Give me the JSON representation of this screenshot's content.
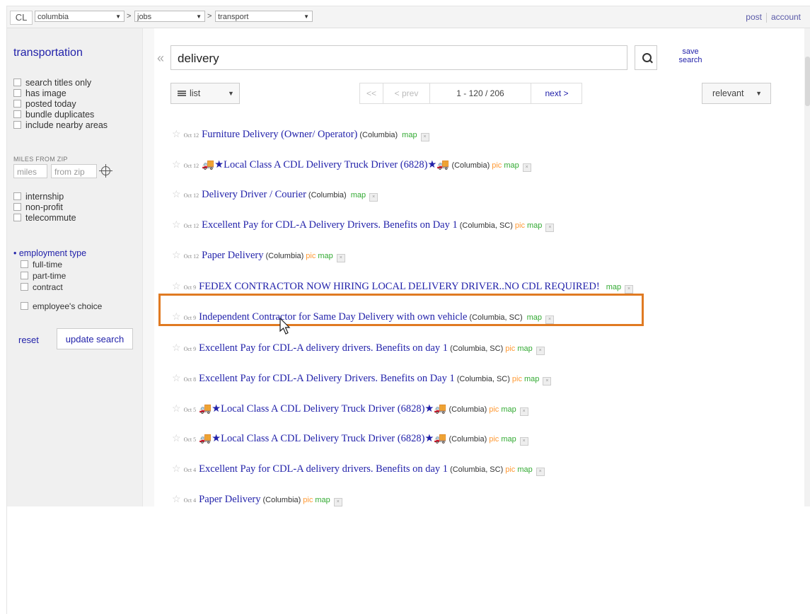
{
  "topbar": {
    "logo": "CL",
    "area": "columbia",
    "section": "jobs",
    "category": "transport",
    "sep": ">",
    "post": "post",
    "account": "account"
  },
  "sidebar": {
    "title": "transportation",
    "filters": [
      "search titles only",
      "has image",
      "posted today",
      "bundle duplicates",
      "include nearby areas"
    ],
    "miles_label": "MILES FROM ZIP",
    "miles_placeholder": "miles",
    "zip_placeholder": "from zip",
    "extras": [
      "internship",
      "non-profit",
      "telecommute"
    ],
    "employment_title": "employment type",
    "employment": [
      "full-time",
      "part-time",
      "contract",
      "employee's choice"
    ],
    "reset": "reset",
    "update": "update search"
  },
  "search": {
    "collapse": "«",
    "query": "delivery",
    "save": "save search"
  },
  "toolbar": {
    "view": "list",
    "first": "<<",
    "prev": "< prev",
    "range": "1 - 120 / 206",
    "next": "next >",
    "sort": "relevant"
  },
  "results": [
    {
      "date": "Oct 12",
      "title": "Furniture Delivery (Owner/ Operator)",
      "hood": "(Columbia)",
      "pic": "",
      "map": "map"
    },
    {
      "date": "Oct 12",
      "title": "🚚★Local Class A CDL Delivery Truck Driver (6828)★🚚",
      "hood": "(Columbia)",
      "pic": "pic",
      "map": "map"
    },
    {
      "date": "Oct 12",
      "title": "Delivery Driver / Courier",
      "hood": "(Columbia)",
      "pic": "",
      "map": "map"
    },
    {
      "date": "Oct 12",
      "title": "Excellent Pay for CDL-A Delivery Drivers. Benefits on Day 1",
      "hood": "(Columbia, SC)",
      "pic": "pic",
      "map": "map"
    },
    {
      "date": "Oct 12",
      "title": "Paper Delivery",
      "hood": "(Columbia)",
      "pic": "pic",
      "map": "map"
    },
    {
      "date": "Oct 9",
      "title": "FEDEX CONTRACTOR NOW HIRING LOCAL DELIVERY DRIVER..NO CDL REQUIRED!",
      "hood": "",
      "pic": "",
      "map": "map"
    },
    {
      "date": "Oct 9",
      "title": "Independent Contractor for Same Day Delivery with own vehicle",
      "hood": "(Columbia, SC)",
      "pic": "",
      "map": "map"
    },
    {
      "date": "Oct 9",
      "title": "Excellent Pay for CDL-A delivery drivers. Benefits on day 1",
      "hood": "(Columbia, SC)",
      "pic": "pic",
      "map": "map"
    },
    {
      "date": "Oct 8",
      "title": "Excellent Pay for CDL-A Delivery Drivers. Benefits on Day 1",
      "hood": "(Columbia, SC)",
      "pic": "pic",
      "map": "map"
    },
    {
      "date": "Oct 5",
      "title": "🚚★Local Class A CDL Delivery Truck Driver (6828)★🚚",
      "hood": "(Columbia)",
      "pic": "pic",
      "map": "map"
    },
    {
      "date": "Oct 5",
      "title": "🚚★Local Class A CDL Delivery Truck Driver (6828)★🚚",
      "hood": "(Columbia)",
      "pic": "pic",
      "map": "map"
    },
    {
      "date": "Oct 4",
      "title": "Excellent Pay for CDL-A delivery drivers. Benefits on day 1",
      "hood": "(Columbia, SC)",
      "pic": "pic",
      "map": "map"
    },
    {
      "date": "Oct 4",
      "title": "Paper Delivery",
      "hood": "(Columbia)",
      "pic": "pic",
      "map": "map"
    }
  ],
  "colors": {
    "link": "#2222aa",
    "pic": "#ff9933",
    "map": "#33aa33",
    "highlight": "#e07a22"
  }
}
